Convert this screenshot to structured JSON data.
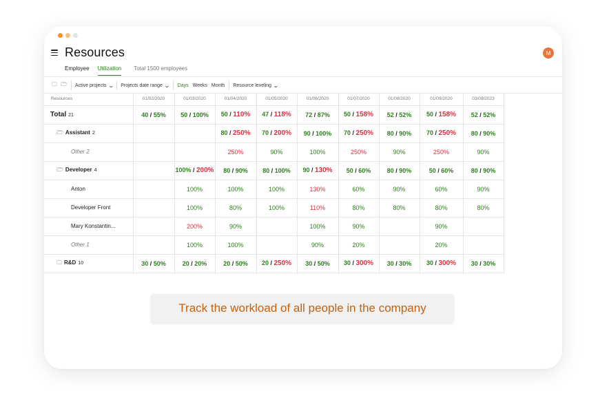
{
  "window": {
    "dot_colors": [
      "#f0942b",
      "#f6c07e",
      "#e5e5e5"
    ]
  },
  "header": {
    "title": "Resources",
    "avatar_initial": "M",
    "avatar_color": "#e8743b"
  },
  "tabs": [
    {
      "label": "Employee",
      "active": false
    },
    {
      "label": "Utilization",
      "active": true
    }
  ],
  "total_employees": "Total 1500 employees",
  "toolbar": {
    "icons": [
      "folder-outline-icon",
      "folder-open-icon"
    ],
    "active_projects": "Active projects",
    "date_range": "Projects date range",
    "scale_options": [
      "Days",
      "Weeks",
      "Month"
    ],
    "active_scale": "Days",
    "resource_leveling": "Resource leveling"
  },
  "colors": {
    "ok": "#2e7d1e",
    "over": "#d8313e",
    "cta_text": "#c4620e"
  },
  "grid": {
    "header_label": "Resources",
    "dates": [
      "01/02/2020",
      "01/03/2020",
      "01/04/2020",
      "01/05/2020",
      "01/06/2020",
      "01/07/2020",
      "01/08/2020",
      "01/09/2020",
      "03/09/2023"
    ],
    "rows": [
      {
        "label": "Total",
        "count": "21",
        "type": "total",
        "cells": [
          "40/55%",
          "50/100%",
          "50/110%",
          "47/118%",
          "72/87%",
          "50/158%",
          "52/52%",
          "50/158%",
          "52/52%"
        ]
      },
      {
        "label": "Assistant",
        "count": "2",
        "type": "group",
        "cells": [
          "",
          "",
          "80/250%",
          "70/200%",
          "90/100%",
          "70/250%",
          "80/90%",
          "70/250%",
          "80/90%"
        ]
      },
      {
        "label": "Other 2",
        "type": "other",
        "cells": [
          "",
          "",
          "250%",
          "90%",
          "100%",
          "250%",
          "90%",
          "250%",
          "90%"
        ]
      },
      {
        "label": "Developer",
        "count": "4",
        "type": "group",
        "cells": [
          "",
          "100%/200%",
          "80/90%",
          "80/100%",
          "90/130%",
          "50/60%",
          "80/90%",
          "50/60%",
          "80/90%"
        ]
      },
      {
        "label": "Anton",
        "type": "person",
        "cells": [
          "",
          "100%",
          "100%",
          "100%",
          "130%",
          "60%",
          "90%",
          "60%",
          "90%"
        ]
      },
      {
        "label": "Developer Front",
        "type": "person",
        "cells": [
          "",
          "100%",
          "80%",
          "100%",
          "110%",
          "80%",
          "80%",
          "80%",
          "80%"
        ]
      },
      {
        "label": "Mary Konstantin...",
        "type": "person",
        "cells": [
          "",
          "200%",
          "90%",
          "",
          "100%",
          "90%",
          "",
          "90%",
          ""
        ]
      },
      {
        "label": "Other 1",
        "type": "other",
        "cells": [
          "",
          "100%",
          "100%",
          "",
          "90%",
          "20%",
          "",
          "20%",
          ""
        ]
      },
      {
        "label": "R&D",
        "count": "10",
        "type": "group-closed",
        "cells": [
          "30/50%",
          "20/20%",
          "20/50%",
          "20/250%",
          "30/50%",
          "30/300%",
          "30/30%",
          "30/300%",
          "30/30%"
        ]
      }
    ]
  },
  "cta": {
    "text": "Track the workload of all people in the company"
  }
}
